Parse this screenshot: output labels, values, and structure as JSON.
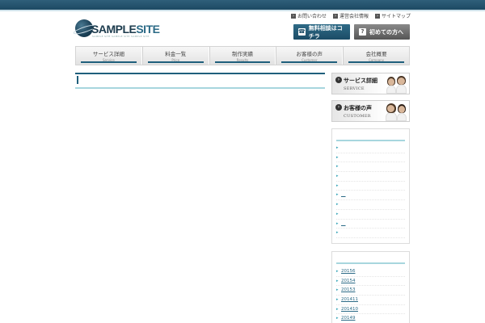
{
  "top_links": [
    "お問い合わせ",
    "運営会社情報",
    "サイトマップ"
  ],
  "logo": {
    "text_main": "SAMPLE",
    "text_sub": "SITE",
    "tagline": "SAMPLE SITE SAMPLE SITE SAMPLE SITE"
  },
  "header_buttons": {
    "contact": "無料相談はコチラ",
    "first": "初めての方へ"
  },
  "nav": [
    {
      "jp": "サービス詳細",
      "en": "Service"
    },
    {
      "jp": "料金一覧",
      "en": "Price"
    },
    {
      "jp": "制作実績",
      "en": "Results"
    },
    {
      "jp": "お客様の声",
      "en": "Customer"
    },
    {
      "jp": "会社概要",
      "en": "Company"
    }
  ],
  "banners": {
    "service": {
      "jp": "サービス詳細",
      "en": "SERVICE"
    },
    "customer": {
      "jp": "お客様の声",
      "en": "CUSTOMER"
    }
  },
  "sidebar_list_a": [
    "",
    "",
    "",
    "",
    "",
    "__",
    "",
    "",
    "__",
    ""
  ],
  "archives": [
    "20156",
    "20154",
    "20153",
    "201411",
    "201410",
    "20149"
  ],
  "colors": {
    "brand": "#1f5f7c",
    "accent_line": "#a7d6de",
    "top_band": "#1d4a63"
  }
}
